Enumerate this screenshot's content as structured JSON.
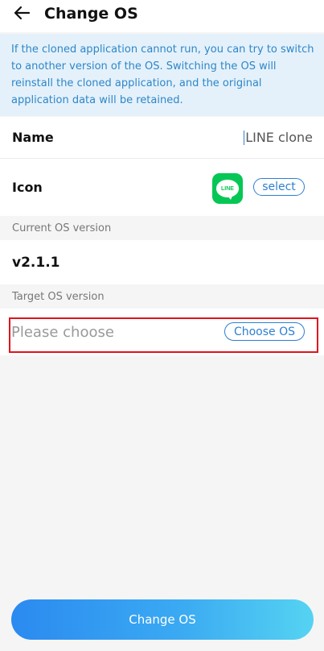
{
  "header": {
    "title": "Change OS",
    "back_icon": "arrow-left-icon"
  },
  "notice": {
    "text": "If the cloned application cannot run, you can try to switch to another version of the OS. Switching the OS will reinstall the cloned application, and the original application data will be retained."
  },
  "name_row": {
    "label": "Name",
    "value": "LINE clone"
  },
  "icon_row": {
    "label": "Icon",
    "app_icon": "line-app-icon",
    "app_icon_text": "LINE",
    "select_label": "select"
  },
  "current_os": {
    "section_label": "Current OS version",
    "value": "v2.1.1"
  },
  "target_os": {
    "section_label": "Target OS version",
    "placeholder": "Please choose",
    "choose_label": "Choose OS"
  },
  "footer": {
    "button_label": "Change OS"
  },
  "colors": {
    "accent": "#2d7fd1",
    "notice_bg": "#e4f1fb",
    "notice_text": "#2f86c7",
    "line_green": "#06c755",
    "highlight_red": "#e0141d"
  }
}
